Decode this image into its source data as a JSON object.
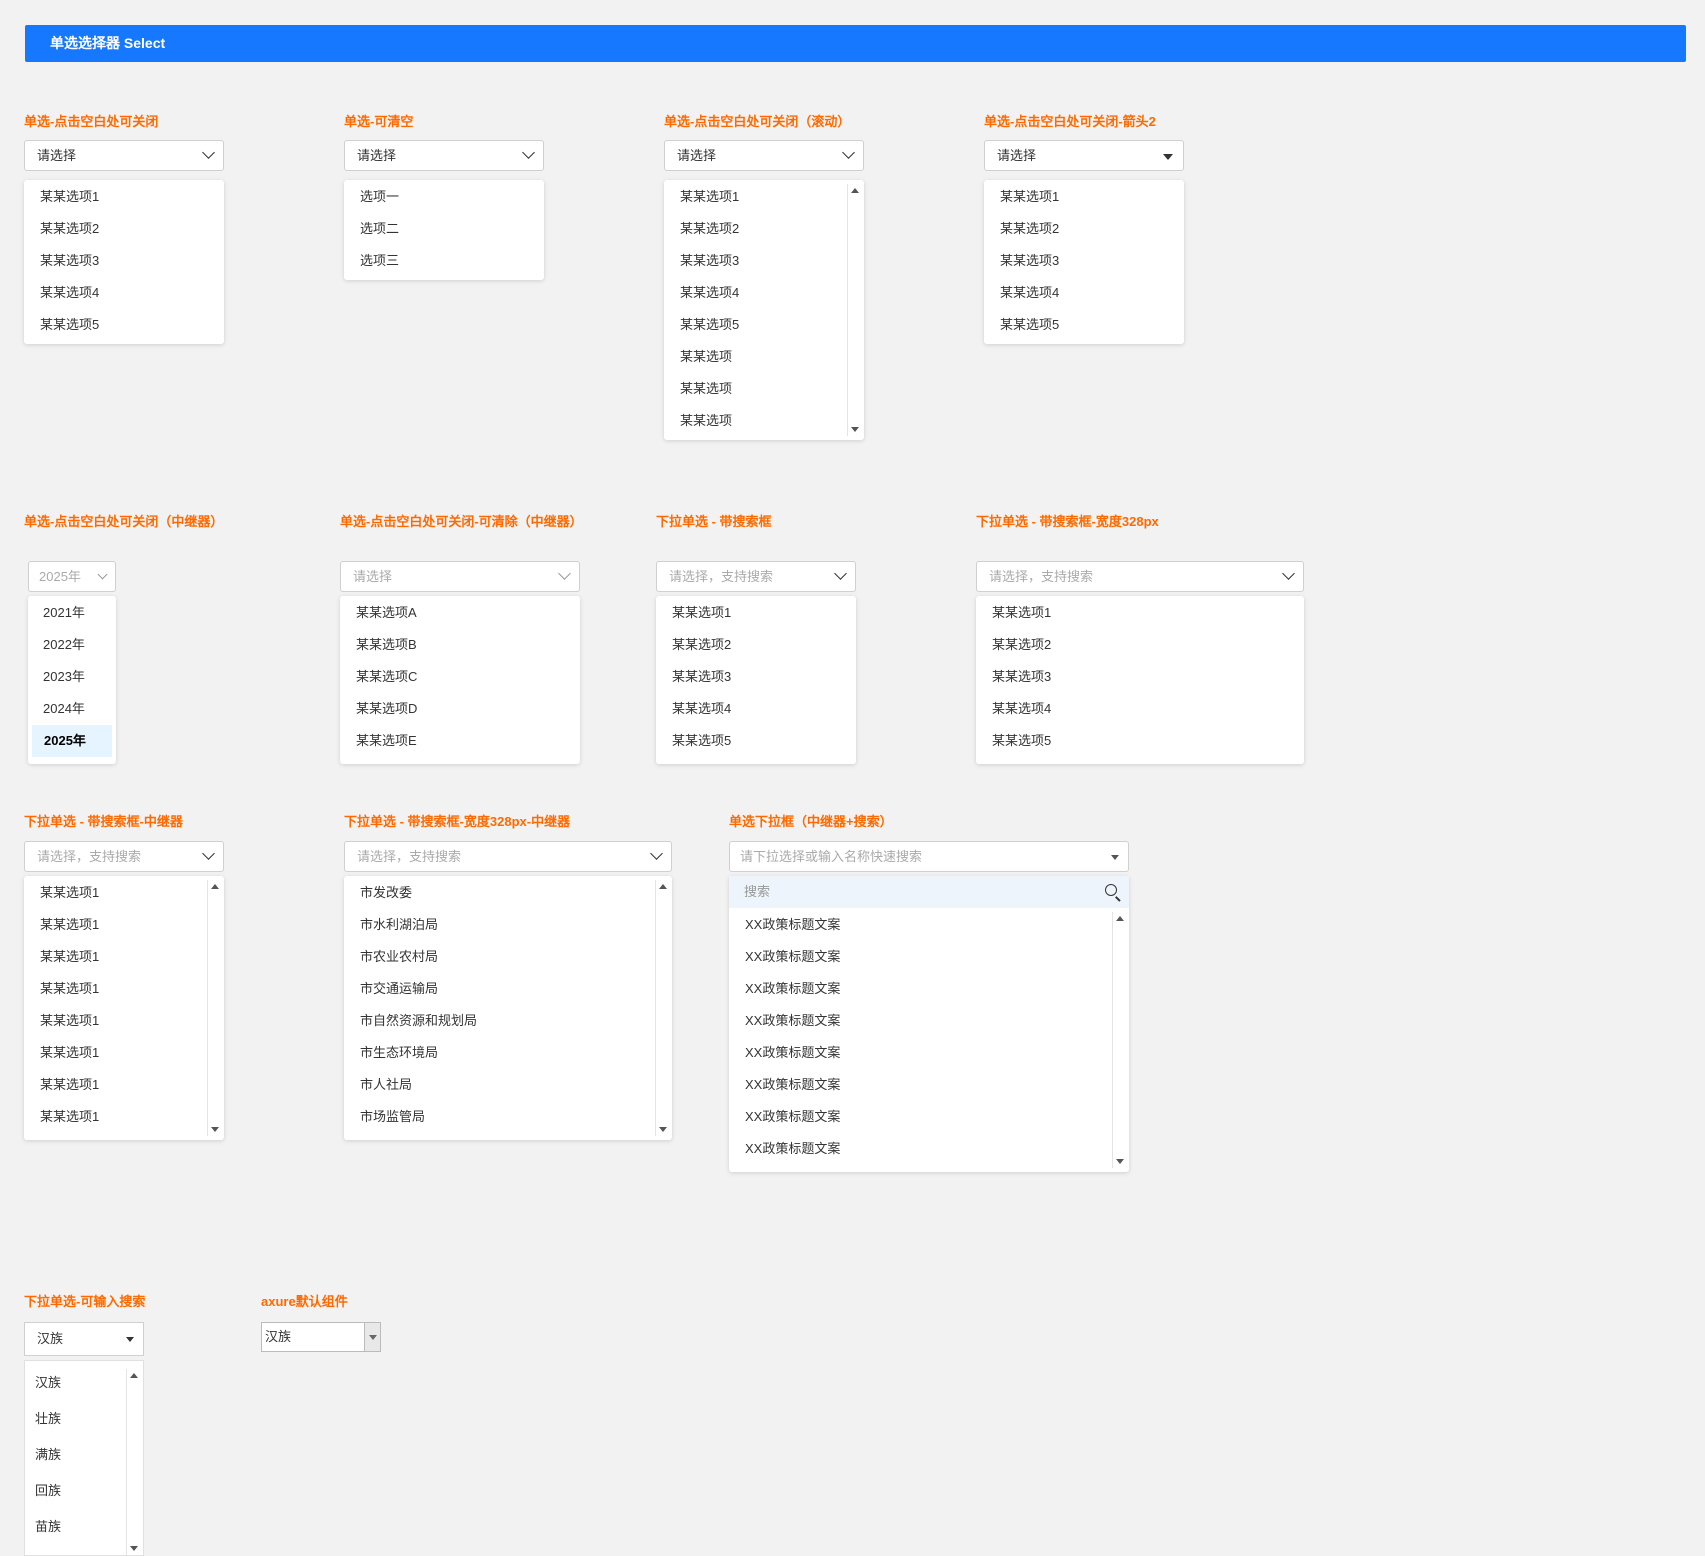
{
  "header": {
    "title": "单选选择器 Select"
  },
  "colors": {
    "accent": "#1677ff",
    "title": "#ff6a00",
    "selected_bg": "#e6f4ff"
  },
  "w1": {
    "title": "单选-点击空白处可关闭",
    "value": "请选择",
    "options": [
      "某某选项1",
      "某某选项2",
      "某某选项3",
      "某某选项4",
      "某某选项5"
    ]
  },
  "w2": {
    "title": "单选-可清空",
    "value": "请选择",
    "options": [
      "选项一",
      "选项二",
      "选项三"
    ]
  },
  "w3": {
    "title": "单选-点击空白处可关闭（滚动）",
    "value": "请选择",
    "options": [
      "某某选项1",
      "某某选项2",
      "某某选项3",
      "某某选项4",
      "某某选项5",
      "某某选项",
      "某某选项",
      "某某选项"
    ]
  },
  "w4": {
    "title": "单选-点击空白处可关闭-箭头2",
    "value": "请选择",
    "options": [
      "某某选项1",
      "某某选项2",
      "某某选项3",
      "某某选项4",
      "某某选项5"
    ]
  },
  "w5": {
    "title": "单选-点击空白处可关闭（中继器）",
    "value": "2025年",
    "options": [
      "2021年",
      "2022年",
      "2023年",
      "2024年",
      "2025年"
    ],
    "selected": "2025年"
  },
  "w6": {
    "title": "单选-点击空白处可关闭-可清除（中继器）",
    "placeholder": "请选择",
    "options": [
      "某某选项A",
      "某某选项B",
      "某某选项C",
      "某某选项D",
      "某某选项E"
    ]
  },
  "w7": {
    "title": "下拉单选 - 带搜索框",
    "placeholder": "请选择，支持搜索",
    "options": [
      "某某选项1",
      "某某选项2",
      "某某选项3",
      "某某选项4",
      "某某选项5"
    ]
  },
  "w8": {
    "title": "下拉单选 - 带搜索框-宽度328px",
    "placeholder": "请选择，支持搜索",
    "options": [
      "某某选项1",
      "某某选项2",
      "某某选项3",
      "某某选项4",
      "某某选项5"
    ]
  },
  "w9": {
    "title": "下拉单选 - 带搜索框-中继器",
    "placeholder": "请选择，支持搜索",
    "options": [
      "某某选项1",
      "某某选项1",
      "某某选项1",
      "某某选项1",
      "某某选项1",
      "某某选项1",
      "某某选项1",
      "某某选项1"
    ]
  },
  "w10": {
    "title": "下拉单选 - 带搜索框-宽度328px-中继器",
    "placeholder": "请选择，支持搜索",
    "options": [
      "市发改委",
      "市水利湖泊局",
      "市农业农村局",
      "市交通运输局",
      "市自然资源和规划局",
      "市生态环境局",
      "市人社局",
      "市场监管局"
    ]
  },
  "w11": {
    "title": "单选下拉框（中继器+搜索）",
    "placeholder": "请下拉选择或输入名称快速搜索",
    "search_placeholder": "搜索",
    "options": [
      "XX政策标题文案",
      "XX政策标题文案",
      "XX政策标题文案",
      "XX政策标题文案",
      "XX政策标题文案",
      "XX政策标题文案",
      "XX政策标题文案",
      "XX政策标题文案"
    ]
  },
  "w12": {
    "title": "下拉单选-可输入搜索",
    "value": "汉族",
    "options": [
      "汉族",
      "壮族",
      "满族",
      "回族",
      "苗族"
    ]
  },
  "w13": {
    "title": "axure默认组件",
    "value": "汉族"
  }
}
